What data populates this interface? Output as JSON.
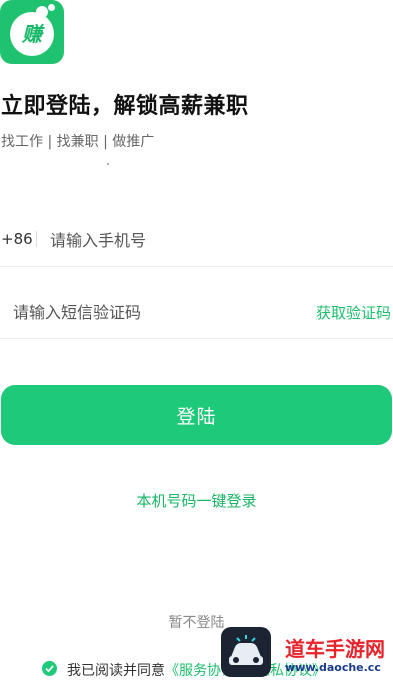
{
  "app": {
    "logo_text": "赚"
  },
  "header": {
    "title": "立即登陆，解锁高薪兼职",
    "subtitle": "找工作 | 找兼职 | 做推广"
  },
  "phone": {
    "country_code": "+86",
    "placeholder": "请输入手机号",
    "value": ""
  },
  "sms": {
    "placeholder": "请输入短信验证码",
    "value": "",
    "get_code_label": "获取验证码"
  },
  "login_button": {
    "label": "登陆"
  },
  "one_click_login": {
    "label": "本机号码一键登录"
  },
  "skip_login": {
    "label": "暂不登陆"
  },
  "agreement": {
    "checked": true,
    "prefix": "我已阅读并同意",
    "service_link": "《服务协议》",
    "privacy_link": "《隐私协议》"
  },
  "watermark": {
    "title": "道车手游网",
    "url": "www.daoche.cc"
  },
  "colors": {
    "brand_green": "#1ec979",
    "link_green": "#1cbf6b",
    "text_dark": "#111111",
    "text_muted": "#666666"
  },
  "icons": {
    "check": "check-circle-icon",
    "logo": "app-logo-icon"
  }
}
